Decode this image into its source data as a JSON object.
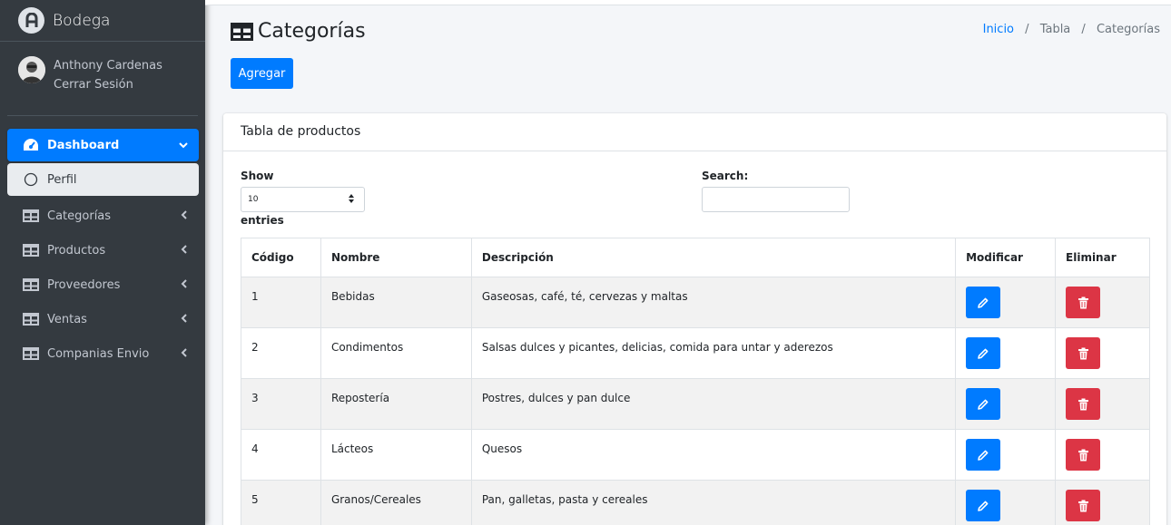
{
  "brand": {
    "name": "Bodega"
  },
  "user": {
    "name": "Anthony Cardenas",
    "logout": "Cerrar Sesión"
  },
  "nav": {
    "items": [
      {
        "label": "Dashboard",
        "icon": "tachometer-icon"
      },
      {
        "label": "Perfil",
        "icon": "circle-icon"
      },
      {
        "label": "Categorías",
        "icon": "table-icon"
      },
      {
        "label": "Productos",
        "icon": "table-icon"
      },
      {
        "label": "Proveedores",
        "icon": "table-icon"
      },
      {
        "label": "Ventas",
        "icon": "table-icon"
      },
      {
        "label": "Companias Envio",
        "icon": "table-icon"
      }
    ]
  },
  "page": {
    "title": "Categorías",
    "add_label": "Agregar"
  },
  "breadcrumb": {
    "home": "Inicio",
    "level1": "Tabla",
    "current": "Categorías"
  },
  "card": {
    "title": "Tabla de productos"
  },
  "controls": {
    "show_label": "Show",
    "entries_value": "10",
    "entries_label": "entries",
    "search_label": "Search:"
  },
  "table": {
    "headers": [
      "Código",
      "Nombre",
      "Descripción",
      "Modificar",
      "Eliminar"
    ],
    "rows": [
      {
        "code": "1",
        "name": "Bebidas",
        "desc": "Gaseosas, café, té, cervezas y maltas"
      },
      {
        "code": "2",
        "name": "Condimentos",
        "desc": "Salsas dulces y picantes, delicias, comida para untar y aderezos"
      },
      {
        "code": "3",
        "name": "Repostería",
        "desc": "Postres, dulces y pan dulce"
      },
      {
        "code": "4",
        "name": "Lácteos",
        "desc": "Quesos"
      },
      {
        "code": "5",
        "name": "Granos/Cereales",
        "desc": "Pan, galletas, pasta y cereales"
      }
    ]
  },
  "colors": {
    "primary": "#007bff",
    "danger": "#dc3545",
    "sidebar": "#343a40"
  }
}
